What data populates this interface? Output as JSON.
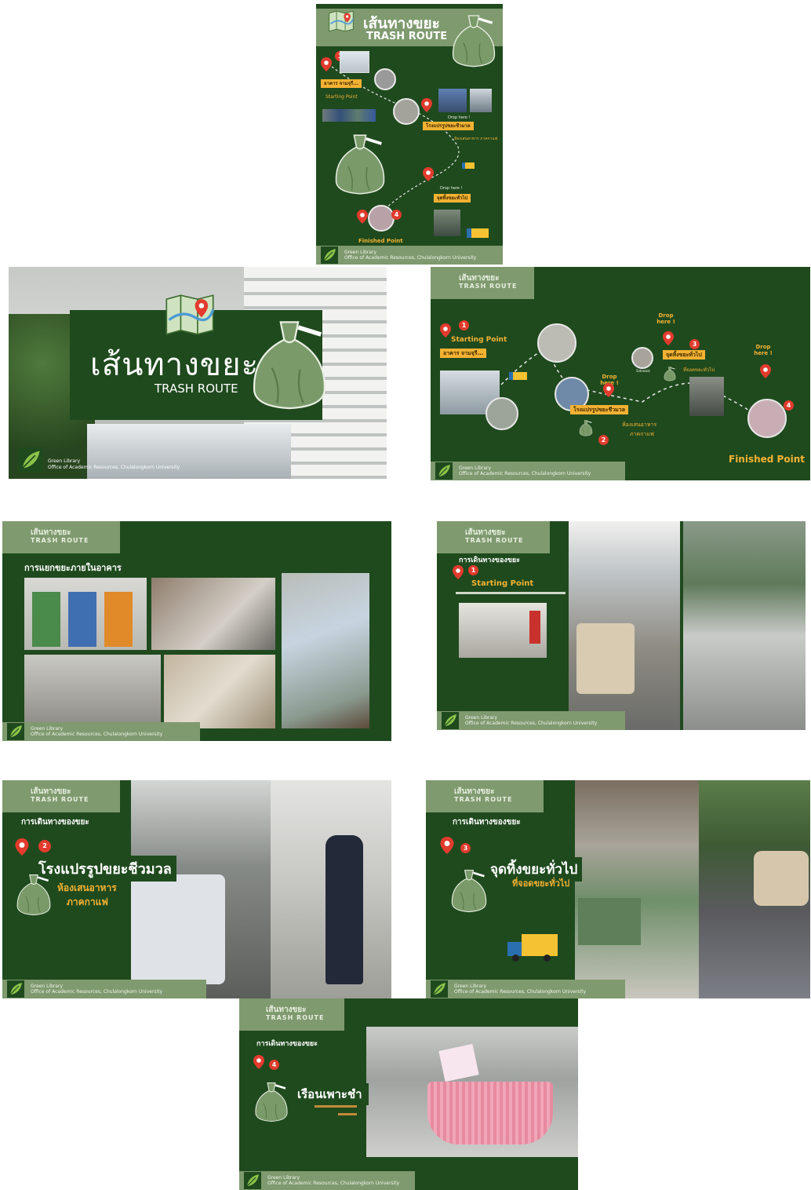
{
  "common": {
    "tag_line1": "เส้นทางขยะ",
    "tag_line2": "TRASH ROUTE",
    "footer_line1": "Green Library",
    "footer_line2": "Office of Academic Resources, Chulalongkorn University"
  },
  "poster": {
    "title_th": "เส้นทางขยะ",
    "title_en": "TRASH ROUTE",
    "start_label": "อาคาร จามจุรี...",
    "start_sub": "Starting Point",
    "drop_label_1": "Drop here !",
    "stop2_label": "โรงแปรรูปขยะชีวมวล",
    "stop2_sub": "ห้องเสนอาหาร ภาคกาแฟ",
    "drop_label_2": "Drop here !",
    "stop3_label": "จุดทิ้งขยะทั่วไป",
    "finish_label": "Finished Point"
  },
  "title_slide": {
    "title_th": "เส้นทางขยะ",
    "title_en": "TRASH ROUTE"
  },
  "map_slide": {
    "start_label": "Starting Point",
    "start_place": "อาคาร จามจุรี...",
    "drop1": "Drop here !",
    "stop2_label": "โรงแปรรูปขยะชีวมวล",
    "stop2_sub1": "ห้องเสนอาหาร",
    "stop2_sub2": "ภาคกาแฟ",
    "drop2": "Drop here !",
    "stop3_label": "จุดทิ้งขยะทั่วไป",
    "stop3_sub": "ที่จอดขยะทั่วไป",
    "drop3": "Drop here !",
    "finish_label": "Finished Point",
    "nums": [
      "1",
      "2",
      "3",
      "4"
    ]
  },
  "sorting_slide": {
    "heading": "การแยกขยะภายในอาคาร"
  },
  "route1_slide": {
    "heading": "การเดินทางของขยะ",
    "num": "1",
    "label": "Starting Point"
  },
  "route2_slide": {
    "heading": "การเดินทางของขยะ",
    "num": "2",
    "label": "โรงแปรรูปขยะชีวมวล",
    "sub1": "ห้องเสนอาหาร",
    "sub2": "ภาคกาแฟ"
  },
  "route3_slide": {
    "heading": "การเดินทางของขยะ",
    "num": "3",
    "label": "จุดทิ้งขยะทั่วไป",
    "sub1": "ที่จอดขยะทั่วไป"
  },
  "route4_slide": {
    "heading": "การเดินทางของขยะ",
    "num": "4",
    "label": "เรือนเพาะชำ"
  }
}
